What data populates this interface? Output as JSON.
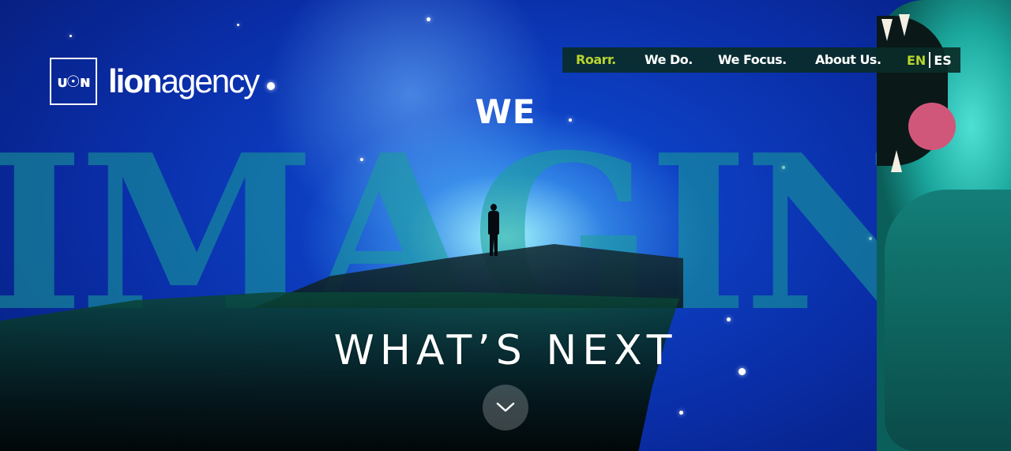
{
  "brand": {
    "name_bold": "lion",
    "name_light": "agency",
    "mark_text": "ᴜ☉ɴ"
  },
  "nav": {
    "items": [
      {
        "label": "Roarr.",
        "active": true
      },
      {
        "label": "We Do.",
        "active": false
      },
      {
        "label": "We Focus.",
        "active": false
      },
      {
        "label": "About Us.",
        "active": false
      }
    ],
    "languages": {
      "current": "EN",
      "other": "ES"
    }
  },
  "hero": {
    "line1": "WE",
    "big_word": "IMAGINE",
    "line3": "WHAT’S NEXT",
    "scroll_icon": "chevron-down-icon"
  },
  "colors": {
    "accent": "#b9d42e",
    "nav_bg": "#0a2d28",
    "big_word": "#19a096"
  }
}
